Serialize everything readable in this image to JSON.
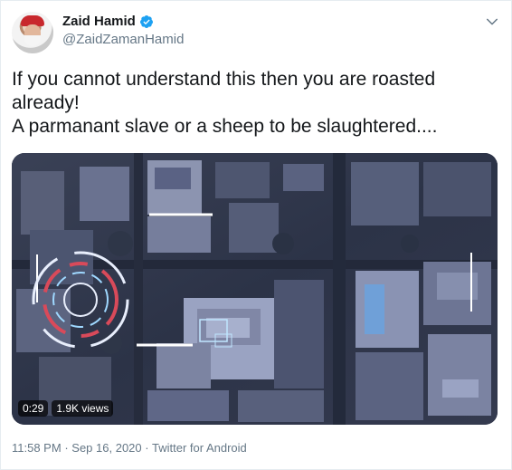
{
  "author": {
    "display_name": "Zaid Hamid",
    "handle": "@ZaidZamanHamid",
    "verified": true,
    "avatar_icon": "profile-photo-red-cap"
  },
  "tweet": {
    "text_lines": [
      "If you cannot understand this then you are roasted",
      "already!",
      "A parmanant slave or a sheep to be slaughtered...."
    ]
  },
  "media": {
    "type": "video",
    "description_icon": "aerial-city-targeting-video",
    "duration": "0:29",
    "views": "1.9K views"
  },
  "footer": {
    "time": "11:58 PM",
    "date": "Sep 16, 2020",
    "separator": "·",
    "client": "Twitter for Android"
  },
  "colors": {
    "text": "#14171a",
    "secondary": "#657786",
    "verified": "#1da1f2",
    "border": "#e6ecf0"
  },
  "icons": {
    "menu": "chevron-down-icon",
    "verified": "verified-badge-icon"
  }
}
